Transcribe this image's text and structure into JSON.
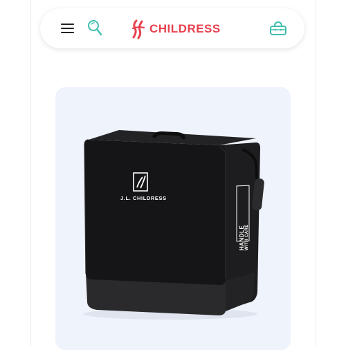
{
  "header": {
    "brand_name": "CHILDRESS",
    "menu_icon": "hamburger-menu-icon",
    "search_icon": "search-icon",
    "cart_icon": "shopping-bag-icon"
  },
  "product": {
    "image_icon": "carrying-bag-product-image",
    "bag_brand_label": "J.L. CHILDRESS",
    "side_label_line1": "HANDLE",
    "side_label_line2": "WITH CARE"
  },
  "colors": {
    "brand_red": "#e8404e",
    "accent_teal": "#3fbfae",
    "card_bg": "#eff3fb"
  }
}
